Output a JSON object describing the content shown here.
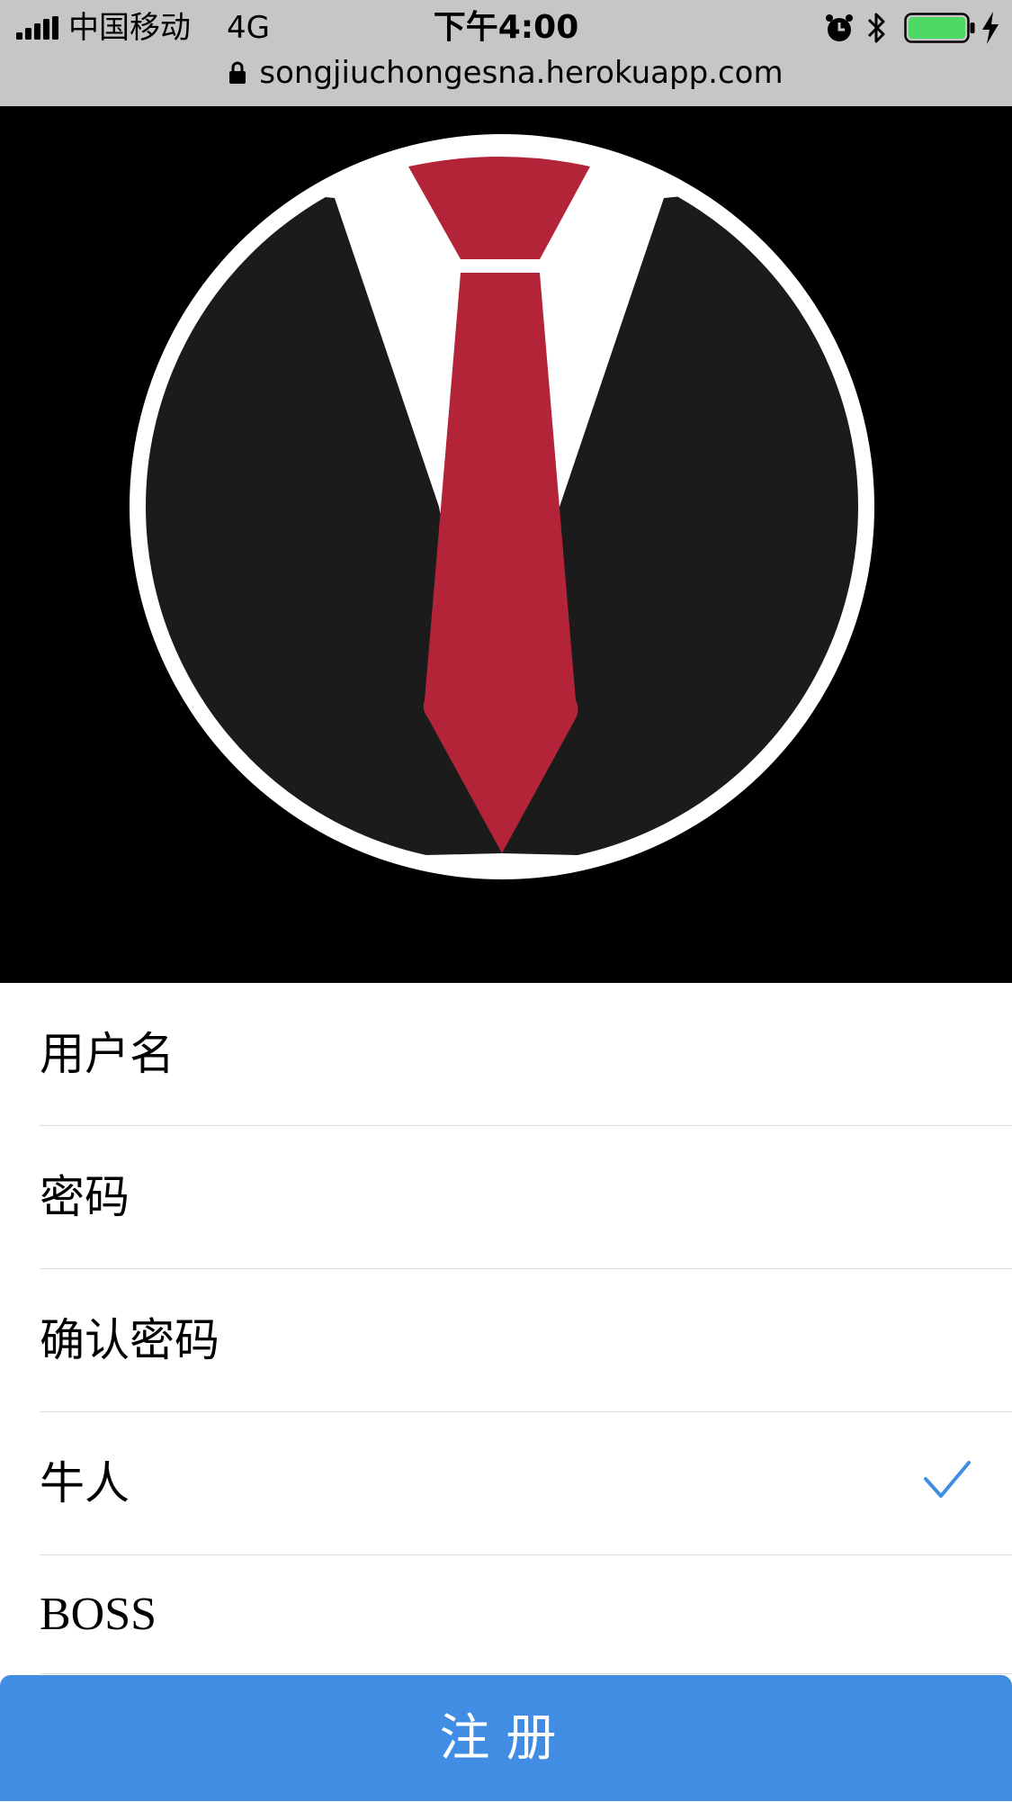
{
  "status_bar": {
    "carrier": "中国移动",
    "network": "4G",
    "time": "下午4:00",
    "battery_level": 1.0,
    "icons": [
      "signal-icon",
      "alarm-icon",
      "bluetooth-icon",
      "battery-icon",
      "charging-icon"
    ]
  },
  "address_bar": {
    "url": "songjiuchongesna.herokuapp.com",
    "icon": "lock-icon"
  },
  "logo": {
    "description_icon": "suit-tie-logo",
    "colors": {
      "background": "#000000",
      "ring": "#ffffff",
      "suit": "#1b1b1b",
      "tie": "#b42439"
    }
  },
  "form": {
    "username_placeholder": "用户名",
    "password_placeholder": "密码",
    "confirm_password_placeholder": "确认密码",
    "role_options": [
      {
        "label": "牛人",
        "selected": true
      },
      {
        "label": "BOSS",
        "selected": false
      }
    ],
    "submit_label": "注册"
  },
  "colors": {
    "accent": "#418de3",
    "check": "#418de3"
  }
}
